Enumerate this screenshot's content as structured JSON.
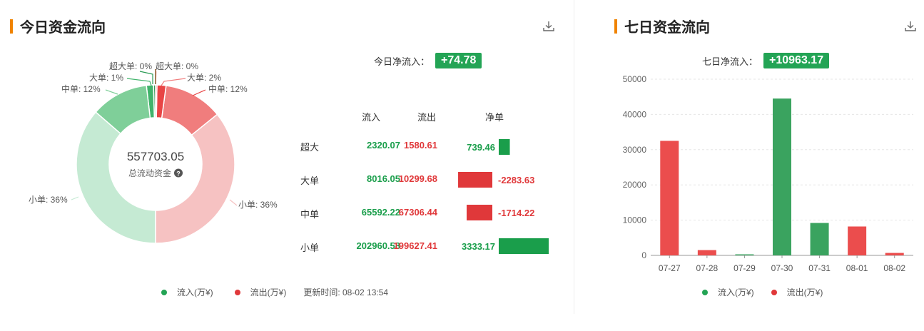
{
  "left": {
    "title": "今日资金流向",
    "net_label": "今日净流入：",
    "net_value": "+74.78",
    "donut": {
      "center_value": "557703.05",
      "center_label": "总流动资金",
      "slice_labels": [
        "超大单: 0%",
        "大单: 1%",
        "中单: 12%",
        "小单: 36%",
        "超大单: 0%",
        "大单: 2%",
        "中单: 12%",
        "小单: 36%"
      ]
    },
    "table": {
      "headers": [
        "流入",
        "流出",
        "净单"
      ],
      "rows": [
        {
          "label": "超大",
          "inflow": "2320.07",
          "outflow": "1580.61",
          "net": "739.46"
        },
        {
          "label": "大单",
          "inflow": "8016.05",
          "outflow": "10299.68",
          "net": "-2283.63"
        },
        {
          "label": "中单",
          "inflow": "65592.22",
          "outflow": "67306.44",
          "net": "-1714.22"
        },
        {
          "label": "小单",
          "inflow": "202960.58",
          "outflow": "199627.41",
          "net": "3333.17"
        }
      ]
    },
    "legend": {
      "inflow": "流入(万¥)",
      "outflow": "流出(万¥)",
      "update": "更新时间: 08-02 13:54"
    }
  },
  "right": {
    "title": "七日资金流向",
    "net_label": "七日净流入：",
    "net_value": "+10963.17",
    "legend": {
      "inflow": "流入(万¥)",
      "outflow": "流出(万¥)"
    }
  },
  "colors": {
    "inflow": "#23a455",
    "outflow": "#e84a4a",
    "accent": "#f08300"
  },
  "chart_data": [
    {
      "type": "pie",
      "title": "今日资金流向",
      "center_value": 557703.05,
      "slices": [
        {
          "label": "超大单",
          "side": "inflow",
          "value": 2320.07,
          "percent": "0%"
        },
        {
          "label": "大单",
          "side": "inflow",
          "value": 8016.05,
          "percent": "1%"
        },
        {
          "label": "中单",
          "side": "inflow",
          "value": 65592.22,
          "percent": "12%"
        },
        {
          "label": "小单",
          "side": "inflow",
          "value": 202960.58,
          "percent": "36%"
        },
        {
          "label": "小单",
          "side": "outflow",
          "value": 199627.41,
          "percent": "36%"
        },
        {
          "label": "中单",
          "side": "outflow",
          "value": 67306.44,
          "percent": "12%"
        },
        {
          "label": "大单",
          "side": "outflow",
          "value": 10299.68,
          "percent": "2%"
        },
        {
          "label": "超大单",
          "side": "outflow",
          "value": 1580.61,
          "percent": "0%"
        }
      ]
    },
    {
      "type": "bar",
      "title": "净单",
      "categories": [
        "超大",
        "大单",
        "中单",
        "小单"
      ],
      "values": [
        739.46,
        -2283.63,
        -1714.22,
        3333.17
      ]
    },
    {
      "type": "bar",
      "title": "七日资金流向",
      "categories": [
        "07-27",
        "07-28",
        "07-29",
        "07-30",
        "07-31",
        "08-01",
        "08-02"
      ],
      "values": [
        32500,
        1500,
        300,
        44500,
        9200,
        8200,
        700
      ],
      "direction": [
        "outflow",
        "outflow",
        "inflow",
        "inflow",
        "inflow",
        "outflow",
        "outflow"
      ],
      "yticks": [
        0,
        10000,
        20000,
        30000,
        40000,
        50000
      ],
      "ylim": [
        0,
        50000
      ],
      "grid": true,
      "legend": "bottom"
    }
  ]
}
